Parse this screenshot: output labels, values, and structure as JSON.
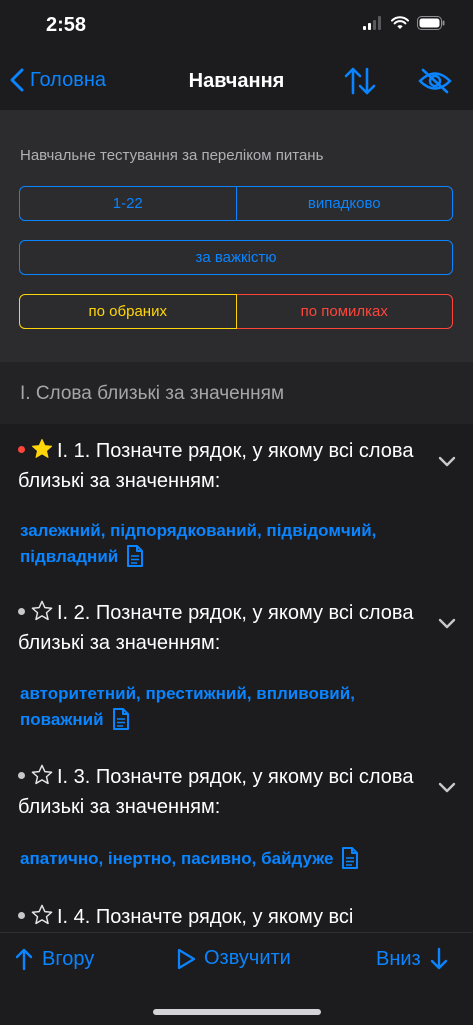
{
  "status": {
    "time": "2:58"
  },
  "nav": {
    "back_label": "Головна",
    "title": "Навчання"
  },
  "settings": {
    "caption": "Навчальне тестування за переліком питань",
    "range_label": "1-22",
    "random_label": "випадково",
    "difficulty_label": "за важкістю",
    "favorites_label": "по обраних",
    "mistakes_label": "по помилках"
  },
  "section": {
    "title": "І. Слова близькі за значенням"
  },
  "questions": [
    {
      "text": "І. 1. Позначте рядок, у якому всі слова близькі за значенням:",
      "answer": "залежний, підпорядкований, підвідомчий, підвладний",
      "favorite": true,
      "dot_color": "#ff453a"
    },
    {
      "text": "І. 2. Позначте рядок, у якому всі слова близькі за значенням:",
      "answer": "авторитетний, престижний, впливовий, поважний",
      "favorite": false,
      "dot_color": "#c7c7cc"
    },
    {
      "text": "І. 3. Позначте рядок, у якому всі слова близькі за значенням:",
      "answer": "апатично, інертно, пасивно, байдуже",
      "favorite": false,
      "dot_color": "#c7c7cc"
    },
    {
      "text": "І. 4. Позначте рядок, у якому всі",
      "answer": "",
      "favorite": false,
      "dot_color": "#c7c7cc"
    }
  ],
  "toolbar": {
    "up_label": "Вгору",
    "speak_label": "Озвучити",
    "down_label": "Вниз"
  },
  "colors": {
    "accent": "#0a84ff",
    "favorite": "#ffd60a",
    "error": "#ff453a",
    "background": "#1c1c1e"
  }
}
